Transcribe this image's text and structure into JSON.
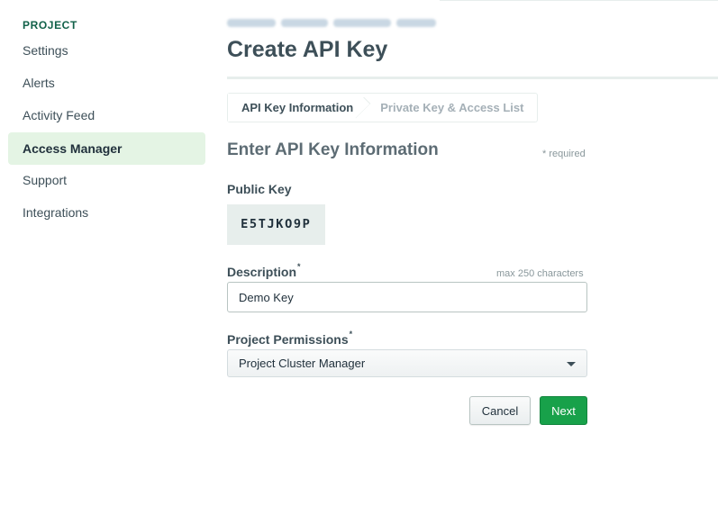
{
  "sidebar": {
    "section": "PROJECT",
    "items": [
      {
        "label": "Settings"
      },
      {
        "label": "Alerts"
      },
      {
        "label": "Activity Feed"
      },
      {
        "label": "Access Manager"
      },
      {
        "label": "Support"
      },
      {
        "label": "Integrations"
      }
    ],
    "active": "Access Manager"
  },
  "page": {
    "title": "Create API Key"
  },
  "wizard": {
    "steps": [
      {
        "label": "API Key Information",
        "state": "current"
      },
      {
        "label": "Private Key & Access List",
        "state": "upcoming"
      }
    ]
  },
  "form": {
    "section_title": "Enter API Key Information",
    "required_note": "* required",
    "public_key": {
      "label": "Public Key",
      "value": "E5TJKO9P"
    },
    "description": {
      "label": "Description",
      "required_mark": "*",
      "hint": "max 250 characters",
      "value": "Demo Key"
    },
    "permissions": {
      "label": "Project Permissions",
      "required_mark": "*",
      "selected": "Project Cluster Manager"
    }
  },
  "actions": {
    "cancel_label": "Cancel",
    "next_label": "Next"
  },
  "colors": {
    "accent_green": "#18a14a",
    "active_bg": "#e4f4e4",
    "section_green": "#116149"
  }
}
